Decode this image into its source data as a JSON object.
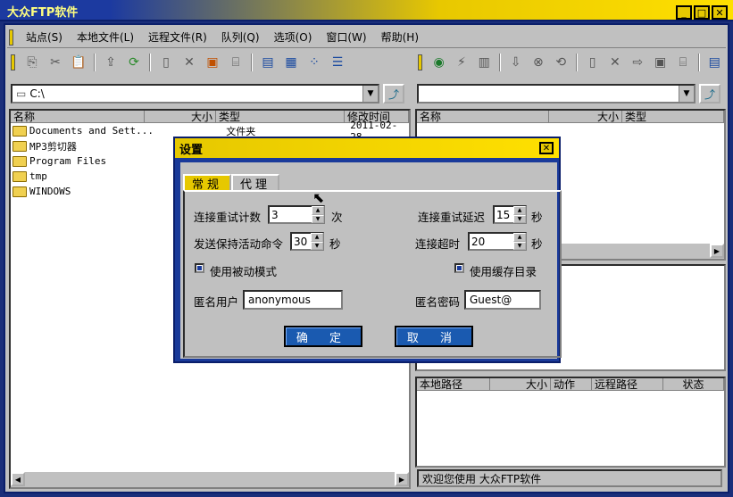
{
  "window": {
    "title": "大众FTP软件",
    "min_icon": "minimize-icon",
    "max_icon": "maximize-icon",
    "close_icon": "close-icon"
  },
  "menu": [
    "站点(S)",
    "本地文件(L)",
    "远程文件(R)",
    "队列(Q)",
    "选项(O)",
    "窗口(W)",
    "帮助(H)"
  ],
  "local": {
    "path": "C:\\",
    "columns": [
      "名称",
      "大小",
      "类型",
      "修改时间"
    ],
    "rows": [
      {
        "name": "Documents and Sett...",
        "size": "",
        "type": "文件夹",
        "modified": "2011-02-28"
      },
      {
        "name": "MP3剪切器",
        "size": "",
        "type": "",
        "modified": ""
      },
      {
        "name": "Program Files",
        "size": "",
        "type": "",
        "modified": ""
      },
      {
        "name": "tmp",
        "size": "",
        "type": "",
        "modified": ""
      },
      {
        "name": "WINDOWS",
        "size": "",
        "type": "",
        "modified": ""
      }
    ]
  },
  "remote": {
    "path": "",
    "columns": [
      "名称",
      "大小",
      "类型"
    ]
  },
  "queue": {
    "columns": [
      "本地路径",
      "大小",
      "动作",
      "远程路径",
      "状态"
    ]
  },
  "status": {
    "text": "欢迎您使用 大众FTP软件"
  },
  "dialog": {
    "title": "设置",
    "tabs": [
      "常规",
      "代理"
    ],
    "retry_count_label": "连接重试计数",
    "retry_count": "3",
    "retry_count_unit": "次",
    "retry_delay_label": "连接重试延迟",
    "retry_delay": "15",
    "retry_delay_unit": "秒",
    "keepalive_label": "发送保持活动命令",
    "keepalive": "30",
    "keepalive_unit": "秒",
    "timeout_label": "连接超时",
    "timeout": "20",
    "timeout_unit": "秒",
    "passive_label": "使用被动模式",
    "passive_checked": true,
    "cache_label": "使用缓存目录",
    "cache_checked": true,
    "anon_user_label": "匿名用户",
    "anon_user": "anonymous",
    "anon_pass_label": "匿名密码",
    "anon_pass": "Guest@",
    "ok_label": "确 定",
    "cancel_label": "取 消"
  },
  "colors": {
    "accent": "#e6c800",
    "frame": "#1a3a9a",
    "button": "#1a5ab0"
  }
}
